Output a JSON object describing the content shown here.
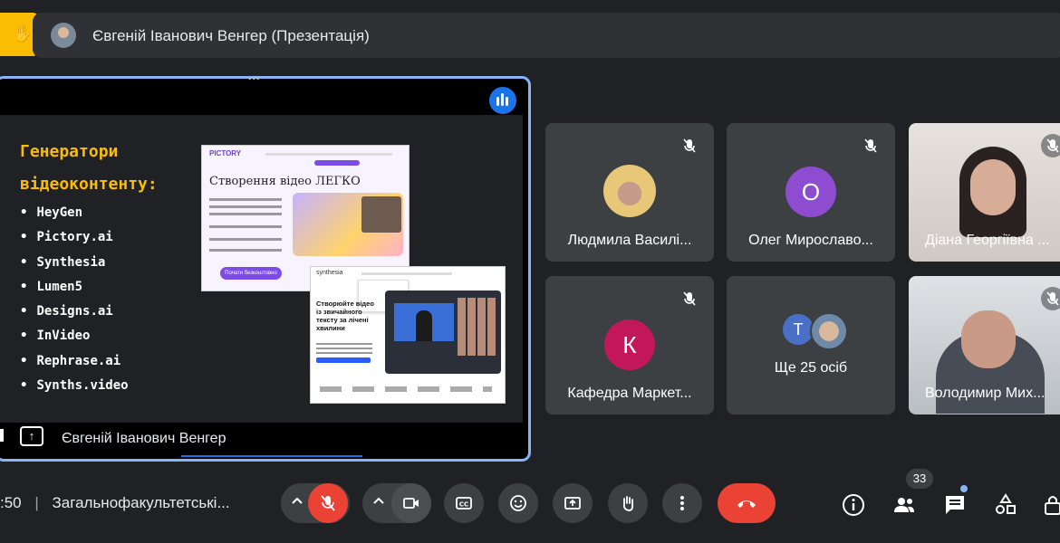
{
  "top_bar": {
    "title": "Євгеній Іванович Венгер (Презентація)"
  },
  "presentation": {
    "presenter_name": "Євгеній Іванович Венгер",
    "slide": {
      "title_line1": "Генератори",
      "title_line2": "відеоконтенту:",
      "tools": [
        "HeyGen",
        "Pictory.ai",
        "Synthesia",
        "Lumen5",
        "Designs.ai",
        "InVideo",
        "Rephrase.ai",
        "Synths.video"
      ],
      "shot1": {
        "brand": "PICTORY",
        "heading": "Створення відео ЛЕГКО",
        "button": "Почати безкоштовно"
      },
      "shot2": {
        "brand": "synthesia",
        "heading": "Створюйте відео із звичайного тексту за лічені хвилини"
      }
    }
  },
  "participants": [
    {
      "name": "Людмила Василі...",
      "type": "photo",
      "muted": true
    },
    {
      "name": "Олег Мирославо...",
      "type": "initial",
      "initial": "О",
      "color": "#8e4cd0",
      "muted": true
    },
    {
      "name": "Діана Георгіївна ...",
      "type": "video",
      "muted": true
    },
    {
      "name": "Кафедра Маркет...",
      "type": "initial",
      "initial": "К",
      "color": "#c2185b",
      "muted": true
    },
    {
      "name": "Ще 25 осіб",
      "type": "more",
      "initial": "Т",
      "color": "#4a6fc6"
    },
    {
      "name": "Володимир Мих...",
      "type": "video",
      "muted": true
    }
  ],
  "bottom_bar": {
    "time": ":50",
    "meeting_name": "Загальнофакультетські...",
    "participants_count": "33"
  },
  "colors": {
    "background": "#202124",
    "accent_blue": "#8ab4f8",
    "red": "#ea4335",
    "slide_title": "#fbbc04"
  }
}
